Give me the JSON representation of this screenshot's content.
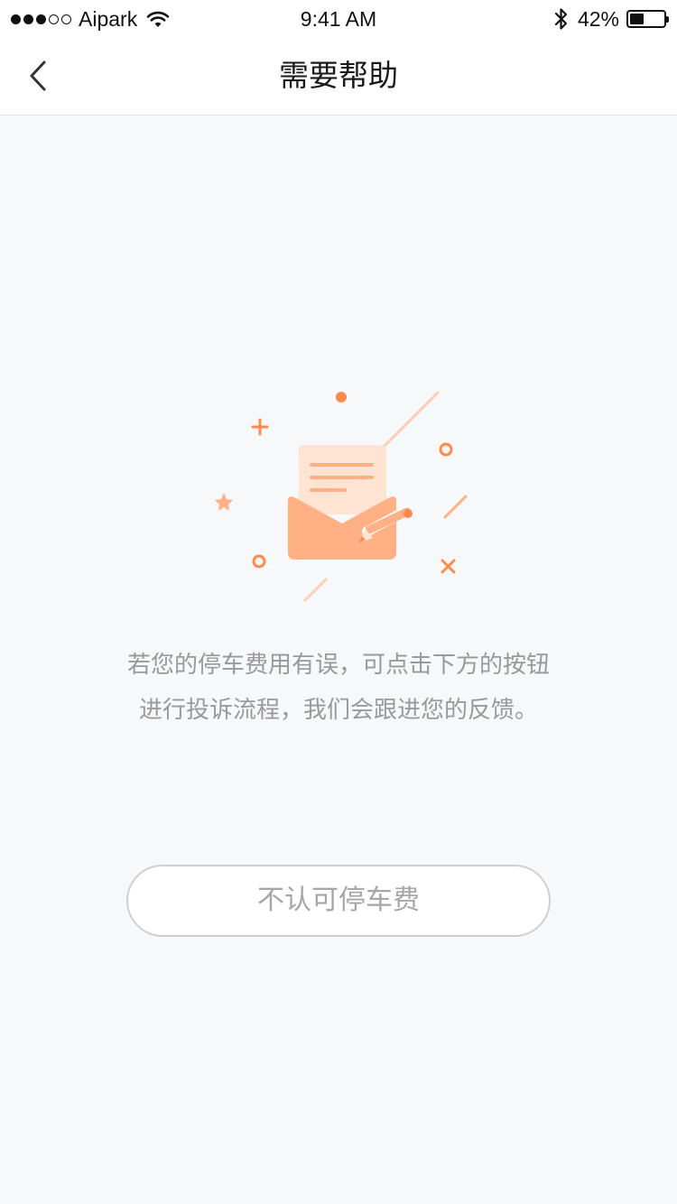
{
  "status_bar": {
    "carrier": "Aipark",
    "time": "9:41 AM",
    "battery_text": "42%",
    "battery_level": 0.42,
    "signal_bars_filled": 3,
    "signal_bars_total": 5
  },
  "nav": {
    "title": "需要帮助",
    "back_icon": "chevron-left-icon"
  },
  "illustration": {
    "icon": "envelope-letter-pencil-icon",
    "accent_color": "#ff8a4c",
    "envelope_color": "#ffb085",
    "letter_color": "#ffe3d3"
  },
  "message": {
    "line1": "若您的停车费用有误，可点击下方的按钮",
    "line2": "进行投诉流程，我们会跟进您的反馈。"
  },
  "actions": {
    "dispute_label": "不认可停车费"
  },
  "colors": {
    "background": "#f7f8fa",
    "header_background": "#ffffff",
    "text_muted": "#999999",
    "button_border": "#cfcfd2"
  }
}
